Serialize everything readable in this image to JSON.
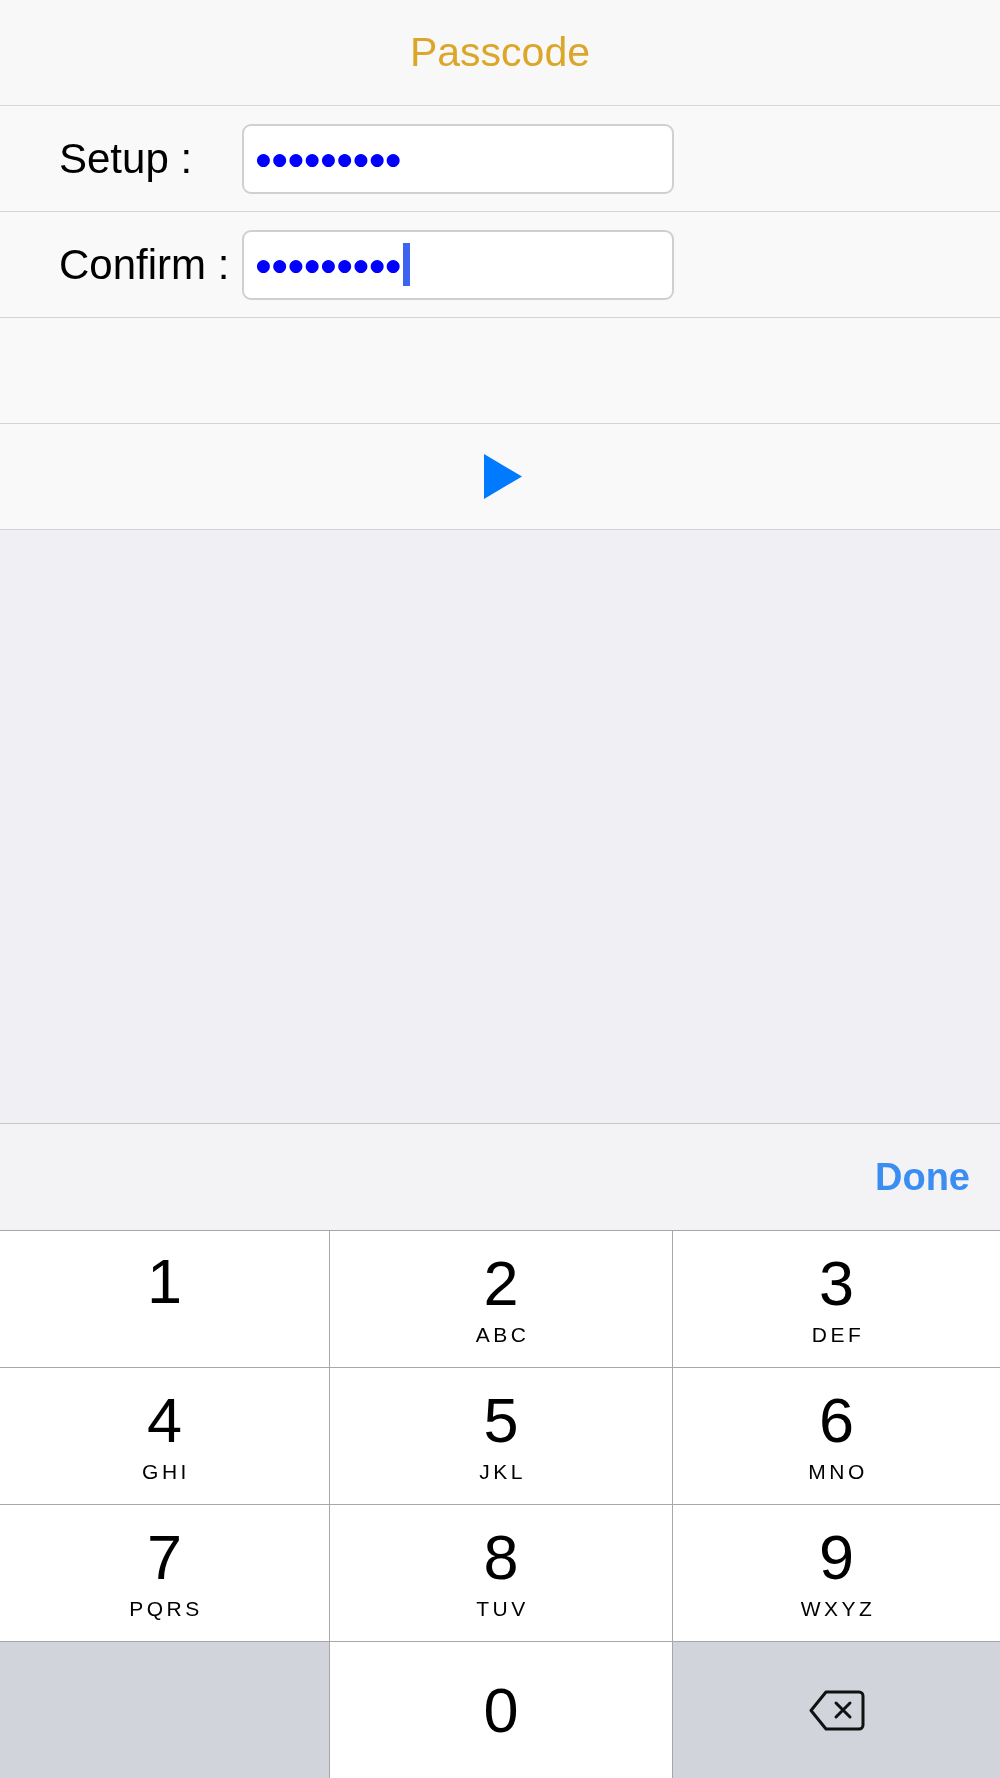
{
  "title": "Passcode",
  "fields": [
    {
      "label": "Setup :",
      "value": "●●●●●●●●●",
      "focused": false
    },
    {
      "label": "Confirm :",
      "value": "●●●●●●●●●",
      "focused": true
    }
  ],
  "toolbar": {
    "done": "Done"
  },
  "keypad": {
    "keys": [
      {
        "kind": "digit",
        "digit": "1"
      },
      {
        "kind": "digit",
        "digit": "2",
        "letters": "ABC"
      },
      {
        "kind": "digit",
        "digit": "3",
        "letters": "DEF"
      },
      {
        "kind": "digit",
        "digit": "4",
        "letters": "GHI"
      },
      {
        "kind": "digit",
        "digit": "5",
        "letters": "JKL"
      },
      {
        "kind": "digit",
        "digit": "6",
        "letters": "MNO"
      },
      {
        "kind": "digit",
        "digit": "7",
        "letters": "PQRS"
      },
      {
        "kind": "digit",
        "digit": "8",
        "letters": "TUV"
      },
      {
        "kind": "digit",
        "digit": "9",
        "letters": "WXYZ"
      },
      {
        "kind": "blank"
      },
      {
        "kind": "digit",
        "digit": "0"
      },
      {
        "kind": "delete"
      }
    ]
  }
}
